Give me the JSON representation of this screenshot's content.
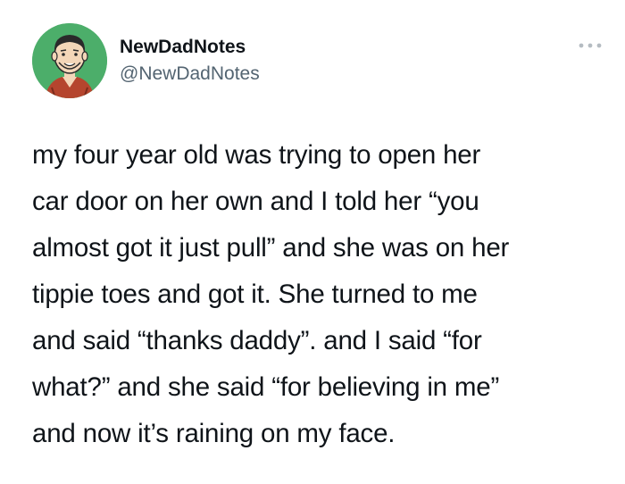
{
  "author": {
    "display_name": "NewDadNotes",
    "handle": "@NewDadNotes",
    "avatar_icon": "cartoon-man-avatar-icon",
    "avatar_bg": "#4cae6a"
  },
  "menu": {
    "icon": "more-options-icon"
  },
  "tweet": {
    "lines": [
      "my four year old was trying to open her",
      "car door on her own and I told her “you",
      "almost got it just pull” and she was on her",
      "tippie toes and got it. She turned to me",
      "and said “thanks daddy”. and I said “for",
      "what?” and she said “for believing in me”",
      "and now it’s raining on my face."
    ]
  },
  "colors": {
    "text": "#0f1419",
    "secondary": "#536471",
    "background": "#ffffff"
  }
}
